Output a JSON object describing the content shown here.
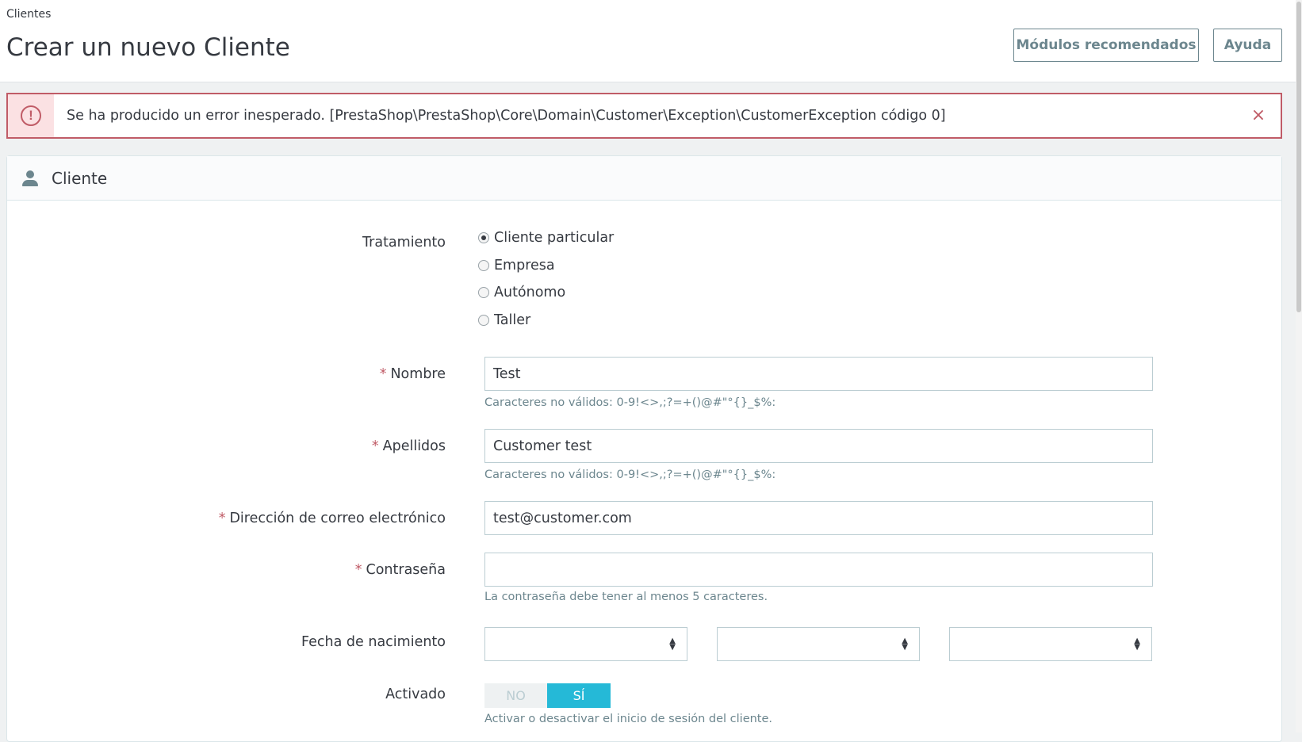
{
  "header": {
    "breadcrumb": "Clientes",
    "title": "Crear un nuevo Cliente",
    "buttons": {
      "modules": "Módulos recomendados",
      "help": "Ayuda"
    }
  },
  "alert": {
    "type": "error",
    "message": "Se ha producido un error inesperado. [PrestaShop\\PrestaShop\\Core\\Domain\\Customer\\Exception\\CustomerException código 0]",
    "icon": "exclamation-circle-icon",
    "close_icon": "×"
  },
  "panel": {
    "title": "Cliente",
    "icon": "person-icon"
  },
  "form": {
    "treatment": {
      "label": "Tratamiento",
      "options": [
        "Cliente particular",
        "Empresa",
        "Autónomo",
        "Taller"
      ],
      "selected": "Cliente particular"
    },
    "first_name": {
      "required": "*",
      "label": "Nombre",
      "value": "Test",
      "help": "Caracteres no válidos: 0-9!<>,;?=+()@#\"°{}_$%:"
    },
    "last_name": {
      "required": "*",
      "label": "Apellidos",
      "value": "Customer test",
      "help": "Caracteres no válidos: 0-9!<>,;?=+()@#\"°{}_$%:"
    },
    "email": {
      "required": "*",
      "label": "Dirección de correo electrónico",
      "value": "test@customer.com"
    },
    "password": {
      "required": "*",
      "label": "Contraseña",
      "value": "",
      "help": "La contraseña debe tener al menos 5 caracteres."
    },
    "birthday": {
      "label": "Fecha de nacimiento",
      "day": "",
      "month": "",
      "year": ""
    },
    "enabled": {
      "label": "Activado",
      "no_label": "NO",
      "yes_label": "SÍ",
      "value": "SÍ",
      "help": "Activar o desactivar el inicio de sesión del cliente."
    }
  },
  "colors": {
    "accent": "#25b9d7",
    "error": "#c05c67",
    "text": "#363a41",
    "muted": "#6c868e"
  }
}
